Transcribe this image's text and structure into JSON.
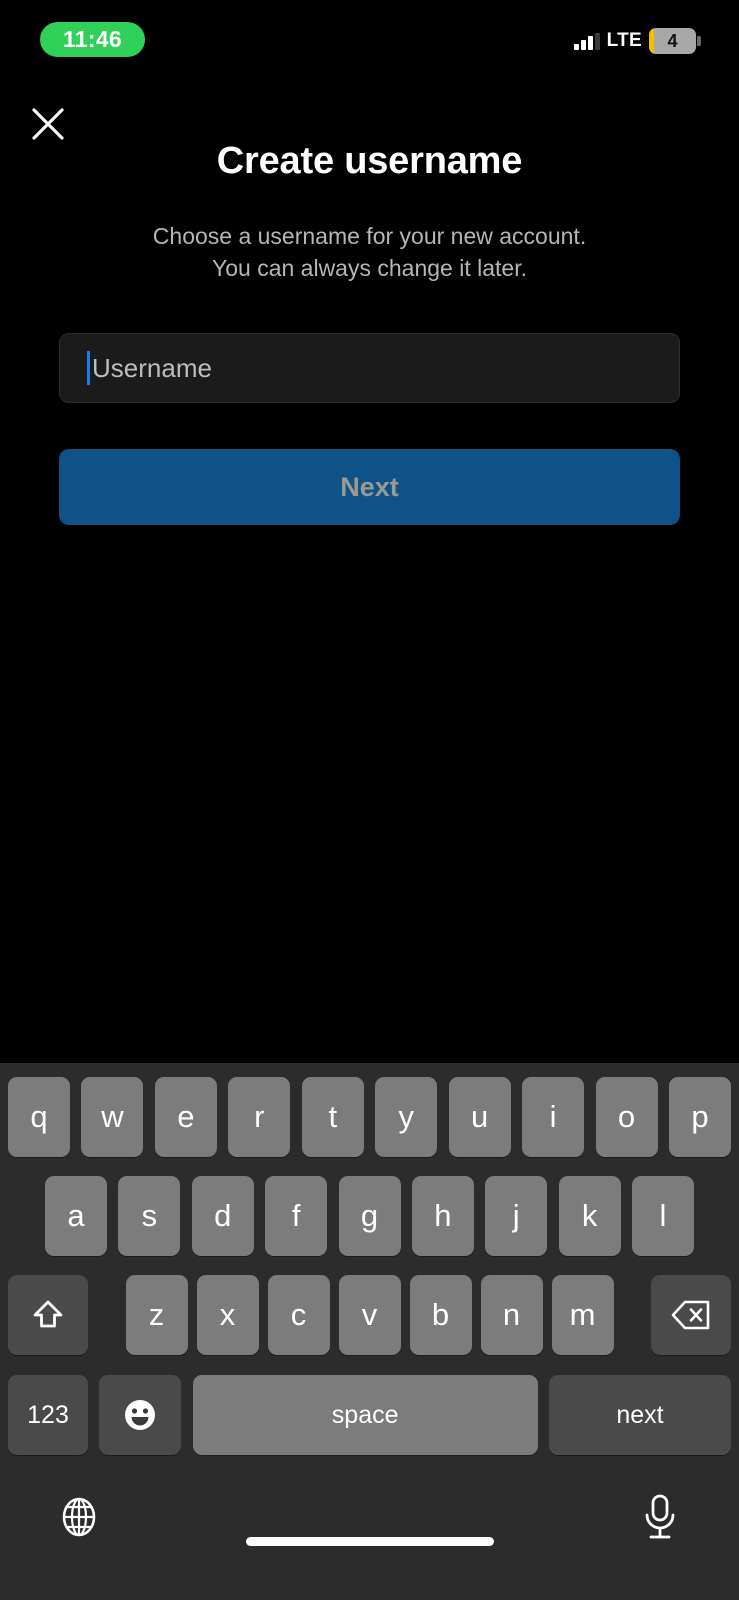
{
  "status_bar": {
    "time": "11:46",
    "time_pill_color": "#2fd158",
    "network_type": "LTE",
    "battery_level": "4",
    "battery_low_power_color": "#f0c000",
    "signal_icon": "signal-bars-icon"
  },
  "header": {
    "close_icon": "close-icon",
    "title": "Create username",
    "subtitle_line_1": "Choose a username for your new account.",
    "subtitle_line_2": "You can always change it later."
  },
  "form": {
    "username_placeholder": "Username",
    "username_value": "",
    "next_label": "Next",
    "next_button_color": "#0f5287",
    "next_label_color": "#9b9a92",
    "cursor_color": "#1a7bea"
  },
  "keyboard": {
    "row_1": [
      "q",
      "w",
      "e",
      "r",
      "t",
      "y",
      "u",
      "i",
      "o",
      "p"
    ],
    "row_2": [
      "a",
      "s",
      "d",
      "f",
      "g",
      "h",
      "j",
      "k",
      "l"
    ],
    "row_3_letters": [
      "z",
      "x",
      "c",
      "v",
      "b",
      "n",
      "m"
    ],
    "shift_icon": "shift-arrow-icon",
    "backspace_icon": "backspace-delete-icon",
    "numbers_label": "123",
    "emoji_icon": "emoji-smiley-icon",
    "space_label": "space",
    "return_label": "next",
    "globe_icon": "globe-icon",
    "mic_icon": "microphone-icon",
    "key_color": "#7c7c7c",
    "modifier_key_color": "#4a4a4a",
    "background_color": "#2c2c2c"
  },
  "home_indicator": "home-indicator-bar"
}
